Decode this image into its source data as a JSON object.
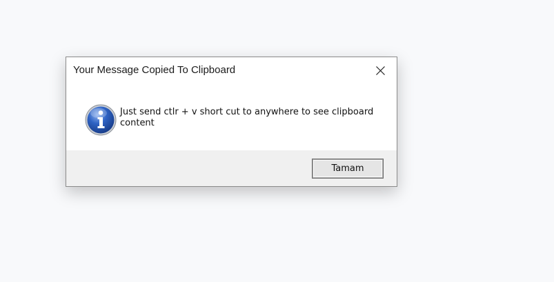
{
  "dialog": {
    "title": "Your Message Copied To Clipboard",
    "close_icon": "close-icon",
    "icon": "information-icon",
    "message": "Just send ctlr + v short cut to anywhere to see clipboard content",
    "ok_label": "Tamam"
  },
  "colors": {
    "background": "#f8f9fb",
    "dialog_body": "#ffffff",
    "footer": "#f0f0f0",
    "icon_blue": "#1f4ea3"
  }
}
